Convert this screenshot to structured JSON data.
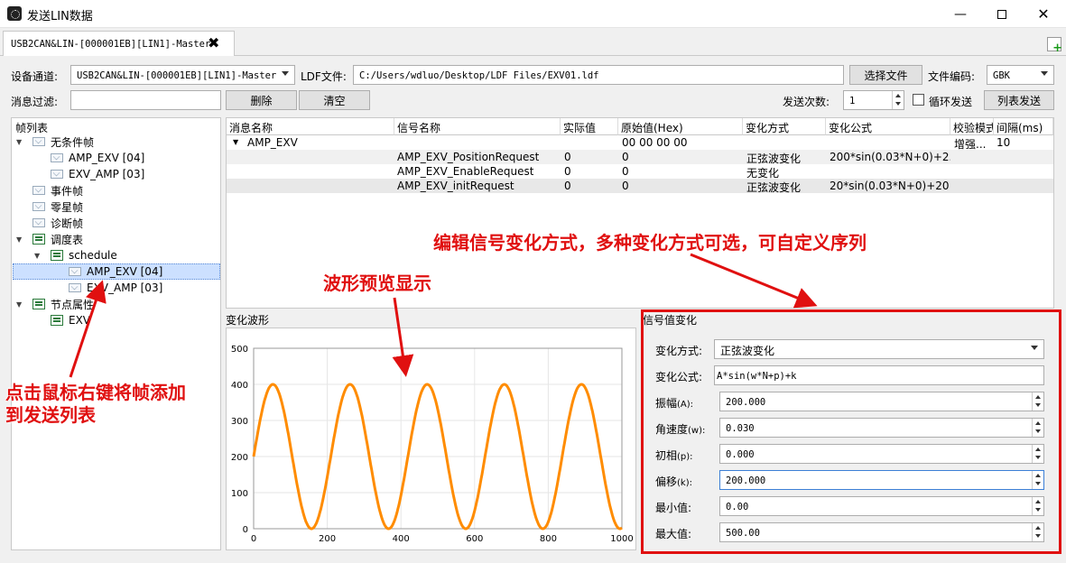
{
  "window": {
    "title": "发送LIN数据"
  },
  "tab": {
    "label": "USB2CAN&LIN-[000001EB][LIN1]-Master"
  },
  "toolbar": {
    "channel_label": "设备通道:",
    "channel_value": "USB2CAN&LIN-[000001EB][LIN1]-Master",
    "ldf_label": "LDF文件:",
    "ldf_path": "C:/Users/wdluo/Desktop/LDF Files/EXV01.ldf",
    "choose_file": "选择文件",
    "encoding_label": "文件编码:",
    "encoding_value": "GBK",
    "filter_label": "消息过滤:",
    "filter_value": "",
    "delete": "删除",
    "clear": "清空",
    "send_count_label": "发送次数:",
    "send_count_value": "1",
    "loop_send": "循环发送",
    "list_send": "列表发送"
  },
  "tree": {
    "header": "帧列表",
    "unconditional": "无条件帧",
    "frame_amp_exv_04": "AMP_EXV [04]",
    "frame_exv_amp_03": "EXV_AMP [03]",
    "event": "事件帧",
    "sporadic": "零星帧",
    "diagnostic": "诊断帧",
    "schedule_table": "调度表",
    "schedule": "schedule",
    "sched_amp_exv": "AMP_EXV [04]",
    "sched_exv_amp": "EXV_AMP [03]",
    "node_attr": "节点属性",
    "node_exv": "EXV"
  },
  "table": {
    "columns": [
      "消息名称",
      "信号名称",
      "实际值",
      "原始值(Hex)",
      "变化方式",
      "变化公式",
      "校验模式",
      "间隔(ms)"
    ],
    "message": {
      "name": "AMP_EXV",
      "raw": "00 00 00 00",
      "check": "增强...",
      "interval": "10"
    },
    "rows": [
      {
        "signal": "AMP_EXV_PositionRequest",
        "actual": "0",
        "raw": "0",
        "mode": "正弦波变化",
        "formula": "200*sin(0.03*N+0)+2..."
      },
      {
        "signal": "AMP_EXV_EnableRequest",
        "actual": "0",
        "raw": "0",
        "mode": "无变化",
        "formula": ""
      },
      {
        "signal": "AMP_EXV_initRequest",
        "actual": "0",
        "raw": "0",
        "mode": "正弦波变化",
        "formula": "20*sin(0.03*N+0)+20"
      }
    ]
  },
  "chart_panel": {
    "title": "变化波形"
  },
  "chart_data": {
    "type": "line",
    "title": "",
    "xlabel": "",
    "ylabel": "",
    "xlim": [
      0,
      1000
    ],
    "ylim": [
      0,
      500
    ],
    "x_ticks": [
      "0",
      "200",
      "400",
      "600",
      "800",
      "1000"
    ],
    "y_ticks": [
      "0",
      "100",
      "200",
      "300",
      "400",
      "500"
    ],
    "series": [
      {
        "formula": "200*sin(0.03*N+0)+200",
        "color": "#ff8c00",
        "x_start": 0,
        "x_end": 1000
      }
    ],
    "grid": true
  },
  "signal_panel": {
    "title": "信号值变化",
    "mode_label": "变化方式:",
    "mode_value": "正弦波变化",
    "formula_label": "变化公式:",
    "formula_value": "A*sin(w*N+p)+k",
    "amp_label": "振幅",
    "amp_sym": "(A):",
    "amp_value": "200.000",
    "omega_label": "角速度",
    "omega_sym": "(w):",
    "omega_value": "0.030",
    "phase_label": "初相",
    "phase_sym": "(p):",
    "phase_value": "0.000",
    "offset_label": "偏移",
    "offset_sym": "(k):",
    "offset_value": "200.000",
    "min_label": "最小值:",
    "min_value": "0.00",
    "max_label": "最大值:",
    "max_value": "500.00"
  },
  "annotations": {
    "edit_mode": "编辑信号变化方式，多种变化方式可选，可自定义序列",
    "waveform": "波形预览显示",
    "right_click_1": "点击鼠标右键将帧添加",
    "right_click_2": "到发送列表",
    "color": "#e01010"
  }
}
